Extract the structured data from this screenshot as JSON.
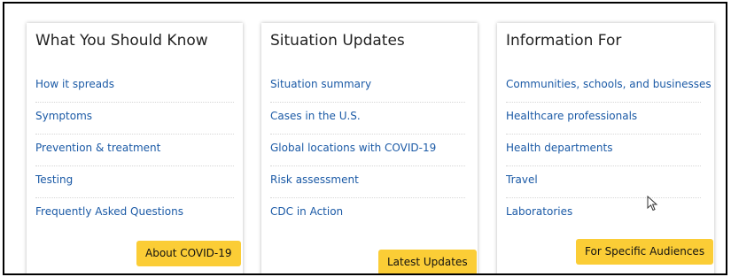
{
  "cards": [
    {
      "title": "What You Should Know",
      "links": [
        "How it spreads",
        "Symptoms",
        "Prevention & treatment",
        "Testing",
        "Frequently Asked Questions"
      ],
      "button": "About COVID-19"
    },
    {
      "title": "Situation Updates",
      "links": [
        "Situation summary",
        "Cases in the U.S.",
        "Global locations with COVID-19",
        "Risk assessment",
        "CDC in Action"
      ],
      "button": "Latest Updates"
    },
    {
      "title": "Information For",
      "links": [
        "Communities, schools, and businesses",
        "Healthcare professionals",
        "Health departments",
        "Travel",
        "Laboratories"
      ],
      "button": "For Specific Audiences"
    }
  ],
  "colors": {
    "link": "#1b5aa6",
    "button": "#fbcd36",
    "title": "#222222"
  },
  "icons": {
    "cursor": "mouse-pointer-icon"
  }
}
